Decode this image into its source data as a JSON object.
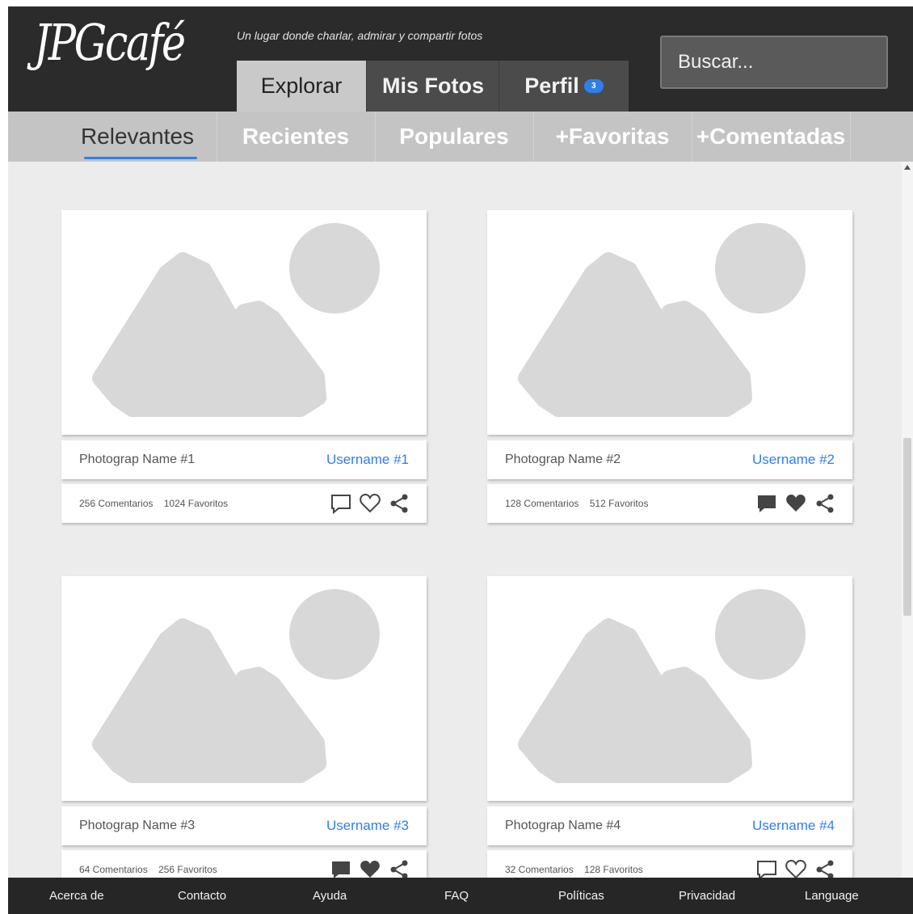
{
  "header": {
    "logo": "JPGcafé",
    "tagline": "Un lugar donde charlar, admirar y compartir fotos",
    "search_placeholder": "Buscar..."
  },
  "main_tabs": [
    {
      "label": "Explorar",
      "active": true
    },
    {
      "label": "Mis Fotos",
      "active": false
    },
    {
      "label": "Perfil",
      "active": false,
      "badge": "3"
    }
  ],
  "sub_tabs": [
    {
      "label": "Relevantes",
      "active": true
    },
    {
      "label": "Recientes",
      "active": false
    },
    {
      "label": "Populares",
      "active": false
    },
    {
      "label": "+Favoritas",
      "active": false
    },
    {
      "label": "+Comentadas",
      "active": false
    }
  ],
  "cards": [
    {
      "photo_name": "Photograp Name #1",
      "username": "Username #1",
      "comments": "256 Comentarios",
      "favorites": "1024 Favoritos",
      "icons": [
        "comment-outline-icon",
        "heart-outline-icon",
        "share-icon"
      ]
    },
    {
      "photo_name": "Photograp Name #2",
      "username": "Username #2",
      "comments": "128 Comentarios",
      "favorites": "512 Favoritos",
      "icons": [
        "comment-filled-icon",
        "heart-filled-icon",
        "share-icon"
      ]
    },
    {
      "photo_name": "Photograp Name #3",
      "username": "Username #3",
      "comments": "64 Comentarios",
      "favorites": "256 Favoritos",
      "icons": [
        "comment-filled-icon",
        "heart-filled-icon",
        "share-icon"
      ]
    },
    {
      "photo_name": "Photograp Name #4",
      "username": "Username #4",
      "comments": "32 Comentarios",
      "favorites": "128 Favoritos",
      "icons": [
        "comment-outline-icon",
        "heart-outline-icon",
        "share-icon"
      ]
    }
  ],
  "footer_links": [
    "Acerca de",
    "Contacto",
    "Ayuda",
    "FAQ",
    "Políticas",
    "Privacidad",
    "Language"
  ],
  "colors": {
    "accent": "#2f7fe9",
    "header_bg": "#2b2b2b",
    "subnav_bg": "#c4c4c4",
    "placeholder_gray": "#d8d8d8"
  }
}
